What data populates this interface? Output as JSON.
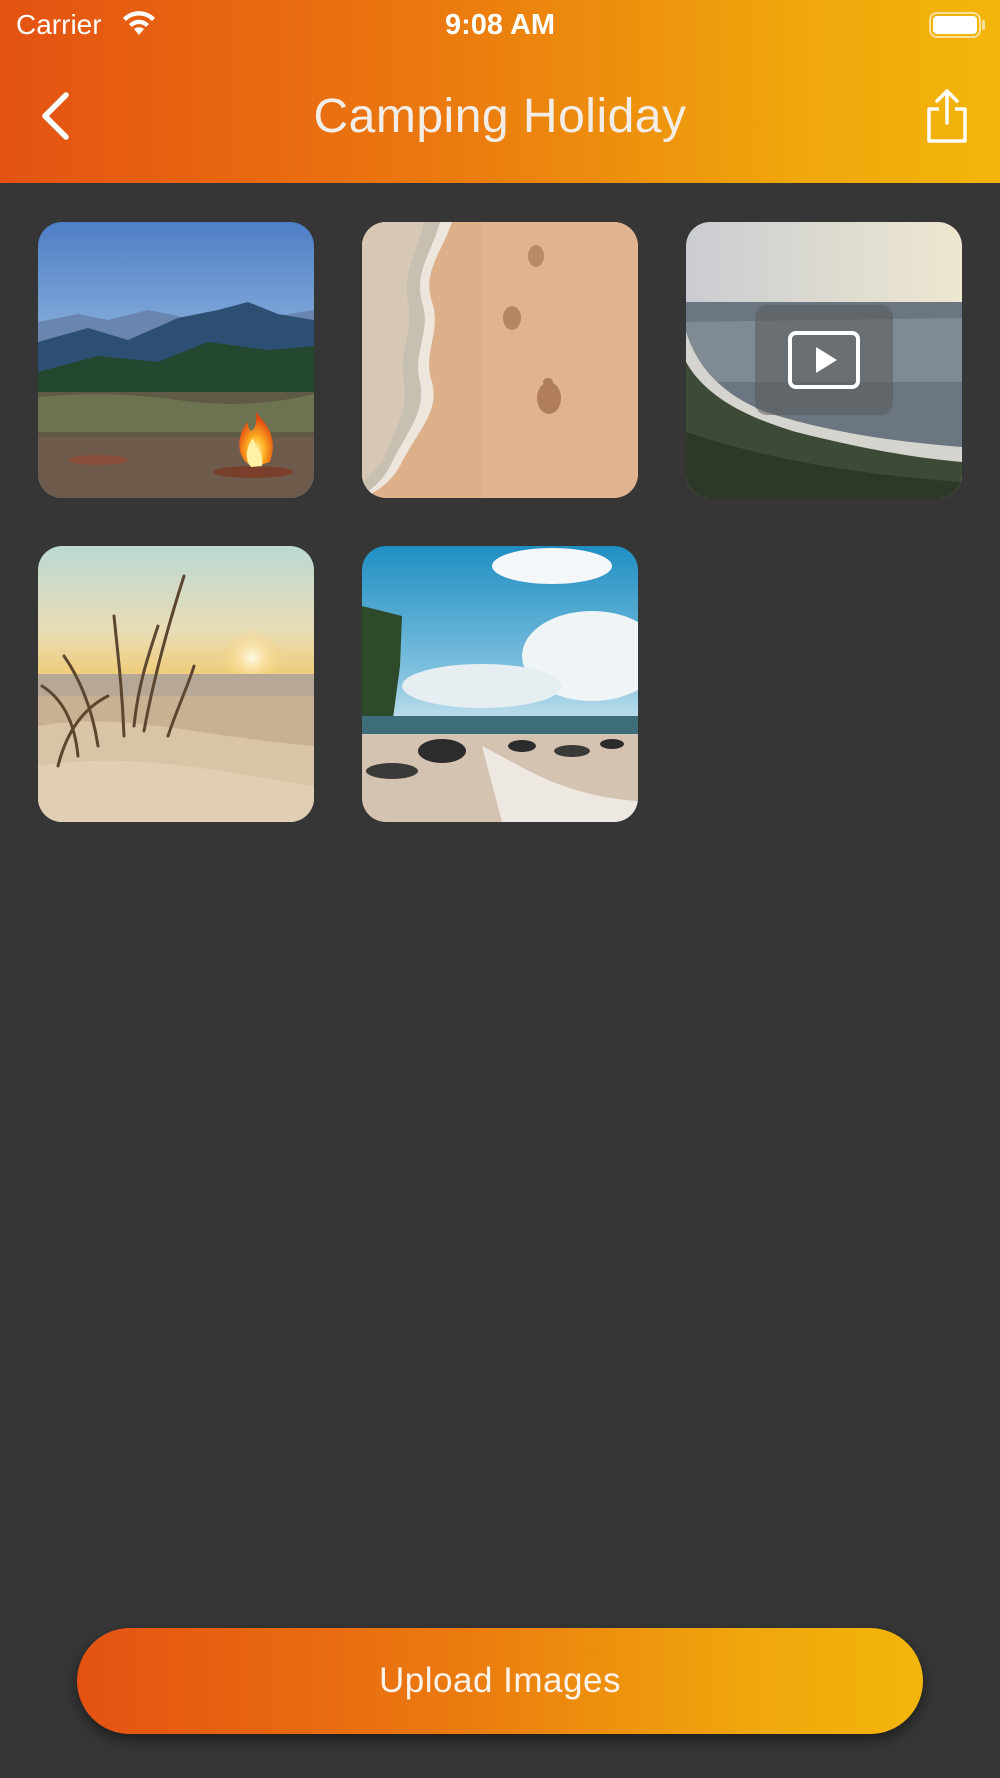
{
  "status_bar": {
    "carrier": "Carrier",
    "time": "9:08 AM",
    "wifi_icon": "wifi-icon",
    "battery_icon": "battery-icon"
  },
  "nav_bar": {
    "back_icon": "chevron-left-icon",
    "title": "Camping Holiday",
    "share_icon": "share-icon"
  },
  "photos": [
    {
      "type": "image",
      "subject": "campfire-mountains"
    },
    {
      "type": "image",
      "subject": "footprints-sand"
    },
    {
      "type": "video",
      "subject": "coastline",
      "overlay_icon": "play-icon"
    },
    {
      "type": "image",
      "subject": "sunset-dunes"
    },
    {
      "type": "image",
      "subject": "rocky-beach"
    }
  ],
  "upload_button": {
    "label": "Upload Images"
  },
  "colors": {
    "accent_start": "#E45212",
    "accent_end": "#F3B50B",
    "background": "#363636"
  }
}
